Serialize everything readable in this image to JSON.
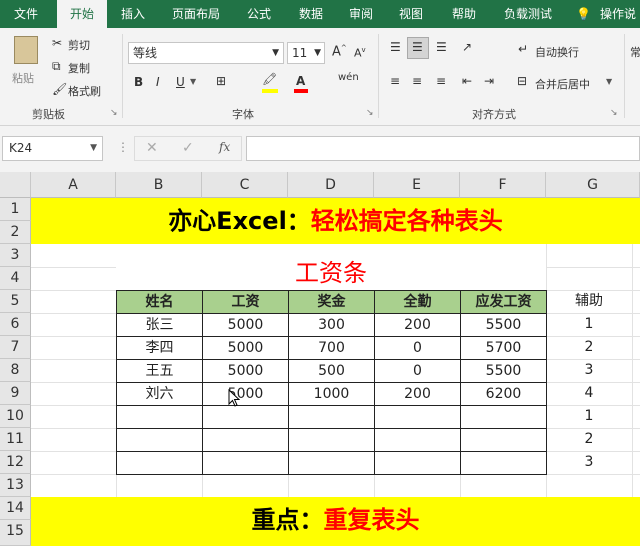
{
  "tabs": [
    "文件",
    "开始",
    "插入",
    "页面布局",
    "公式",
    "数据",
    "审阅",
    "视图",
    "帮助",
    "负载测试",
    "操作说"
  ],
  "ribbon": {
    "paste_label": "粘贴",
    "cut_label": "剪切",
    "copy_label": "复制",
    "format_painter_label": "格式刷",
    "clipboard_group": "剪贴板",
    "font_name": "等线",
    "font_size": "11",
    "font_group": "字体",
    "wrap_text_label": "自动换行",
    "merge_center_label": "合并后居中",
    "alignment_group": "对齐方式",
    "style_partial": "常"
  },
  "formula_bar": {
    "name_box": "K24",
    "fx": "fx",
    "content": ""
  },
  "columns": [
    "A",
    "B",
    "C",
    "D",
    "E",
    "F",
    "G"
  ],
  "rows": [
    "1",
    "2",
    "3",
    "4",
    "5",
    "6",
    "7",
    "8",
    "9",
    "10",
    "11",
    "12",
    "13",
    "14",
    "15"
  ],
  "sheet": {
    "banner_prefix": "亦心Excel：",
    "banner_highlight": "轻松搞定各种表头",
    "table_title": "工资条",
    "headers": [
      "姓名",
      "工资",
      "奖金",
      "全勤",
      "应发工资"
    ],
    "aux_header": "辅助",
    "table_rows": [
      [
        "张三",
        "5000",
        "300",
        "200",
        "5500"
      ],
      [
        "李四",
        "5000",
        "700",
        "0",
        "5700"
      ],
      [
        "王五",
        "5000",
        "500",
        "0",
        "5500"
      ],
      [
        "刘六",
        "5000",
        "1000",
        "200",
        "6200"
      ],
      [
        "",
        "",
        "",
        "",
        ""
      ],
      [
        "",
        "",
        "",
        "",
        ""
      ],
      [
        "",
        "",
        "",
        "",
        ""
      ]
    ],
    "aux_values": [
      "1",
      "2",
      "3",
      "4",
      "1",
      "2",
      "3"
    ],
    "footer_prefix": "重点：",
    "footer_highlight": "重复表头"
  },
  "colors": {
    "excel_green": "#217346",
    "banner_yellow": "#ffff00",
    "header_green": "#a9d08e",
    "title_red": "#ff0000"
  }
}
